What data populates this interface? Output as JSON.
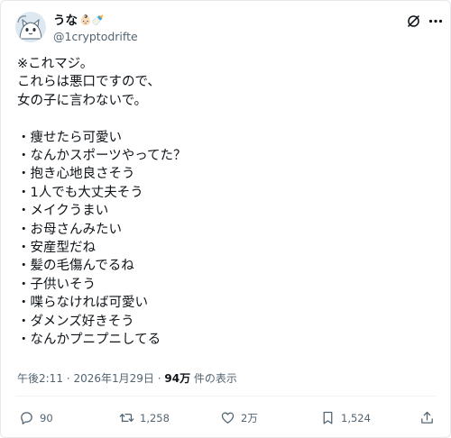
{
  "author": {
    "display_name": "うな",
    "emoji": "👶🏻🍼",
    "handle": "@1cryptodrifte",
    "avatar_icon": "cartoon-cat-avatar"
  },
  "header_icons": {
    "grok": "grok-icon",
    "more": "more-icon"
  },
  "tweet": {
    "text": "※これマジ。\nこれらは悪口ですので、\n女の子に言わないで。\n\n・痩せたら可愛い\n・なんかスポーツやってた？\n・抱き心地良さそう\n・1人でも大丈夫そう\n・メイクうまい\n・お母さんみたい\n・安産型だね\n・髪の毛傷んでるね\n・子供いそう\n・喋らなければ可愛い\n・ダメンズ好きそう\n・なんかプニプニしてる"
  },
  "meta": {
    "time": "午後2:11",
    "separator": "·",
    "date": "2026年1月29日",
    "views_count": "94万",
    "views_label": "件の表示"
  },
  "actions": {
    "reply": {
      "count": "90",
      "icon": "reply-icon"
    },
    "repost": {
      "count": "1,258",
      "icon": "repost-icon"
    },
    "like": {
      "count": "2万",
      "icon": "heart-icon"
    },
    "bookmark": {
      "count": "1,524",
      "icon": "bookmark-icon"
    },
    "share": {
      "icon": "share-icon"
    }
  },
  "colors": {
    "text": "#0f1419",
    "secondary": "#536471",
    "border": "#e6e8ea"
  }
}
